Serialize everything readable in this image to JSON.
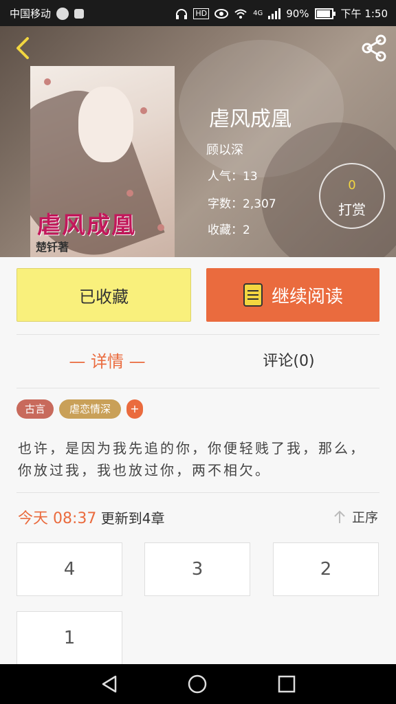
{
  "status_bar": {
    "carrier": "中国移动",
    "hd": "HD",
    "network": "4G",
    "battery": "90%",
    "time": "下午 1:50"
  },
  "book": {
    "title": "虐风成凰",
    "author": "顾以深",
    "popularity": "人气：13",
    "word_count": "字数：2,307",
    "favorites": "收藏：2",
    "cover_title": "虐风成凰",
    "cover_author": "楚钎著"
  },
  "reward": {
    "count": "0",
    "label": "打赏"
  },
  "actions": {
    "favorite_label": "已收藏",
    "continue_label": "继续阅读"
  },
  "tabs": {
    "detail": "— 详情 —",
    "comments": "评论(0)"
  },
  "tags": [
    "古言",
    "虐恋情深"
  ],
  "tag_add": "+",
  "synopsis": "也许，是因为我先追的你，你便轻贱了我，那么，你放过我，我也放过你，两不相欠。",
  "update": {
    "highlight": "今天 08:37",
    "text": " 更新到4章"
  },
  "sort_label": "正序",
  "chapters": [
    "4",
    "3",
    "2",
    "1"
  ],
  "colors": {
    "accent": "#ea6b3e",
    "favorite_bg": "#f9f07c",
    "reward_count": "#f2d640"
  },
  "icons": [
    "back-icon",
    "share-icon",
    "book-icon",
    "arrow-up-icon",
    "nav-back-icon",
    "nav-home-icon",
    "nav-recent-icon"
  ]
}
